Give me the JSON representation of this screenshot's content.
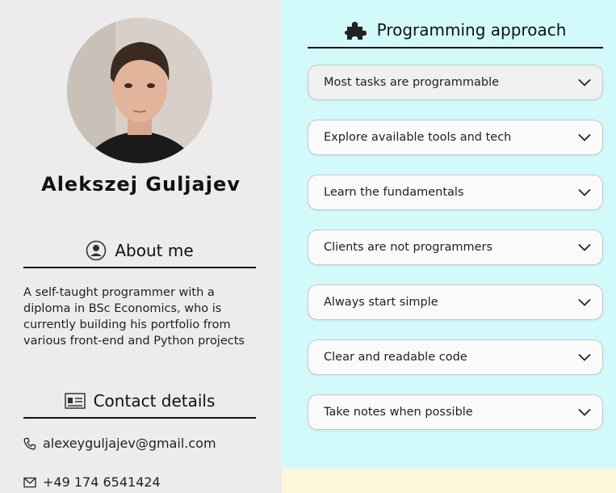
{
  "profile": {
    "name": "Alekszej Guljajev"
  },
  "about": {
    "title": "About me",
    "text": "A self-taught programmer with a diploma in BSc Economics, who is currently building his portfolio from various front-end and Python projects",
    "icon": "user-circle-icon"
  },
  "contact": {
    "title": "Contact details",
    "icon": "id-card-icon",
    "email": "alexeyguljajev@gmail.com",
    "phone": "+49 174 6541424"
  },
  "approach": {
    "title": "Programming approach",
    "icon": "puzzle-icon",
    "items": [
      {
        "label": "Most tasks are programmable"
      },
      {
        "label": "Explore available tools and tech"
      },
      {
        "label": "Learn the fundamentals"
      },
      {
        "label": "Clients are not programmers"
      },
      {
        "label": "Always start simple"
      },
      {
        "label": "Clear and readable code"
      },
      {
        "label": "Take notes when possible"
      }
    ]
  },
  "colors": {
    "left_bg": "#ececec",
    "right_bg": "#d3fafa",
    "footer_bg": "#fdf7dc"
  }
}
